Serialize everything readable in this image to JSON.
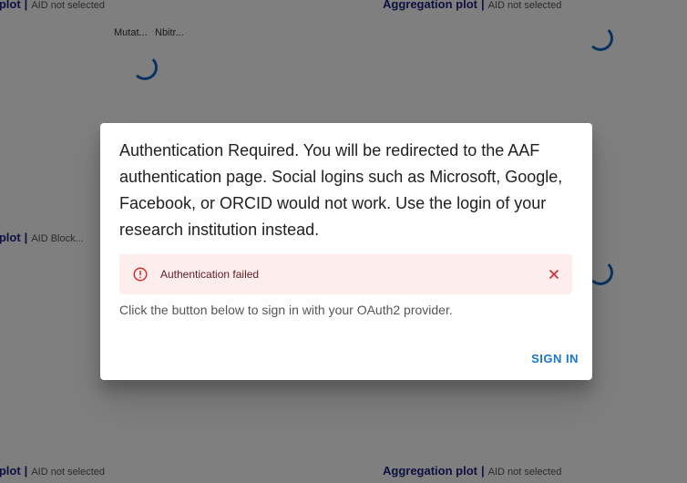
{
  "background": {
    "plots": [
      {
        "title": "y plot",
        "subtitle": "AID not selected"
      },
      {
        "title": "Aggregation plot",
        "subtitle": "AID not selected"
      },
      {
        "title": "y plot",
        "subtitle": "AID Block..."
      },
      {
        "title": "y plot",
        "subtitle": "AID not selected"
      },
      {
        "title": "Aggregation plot",
        "subtitle": "AID not selected"
      }
    ],
    "axis_labels": [
      "Mutat...",
      "Nbitr..."
    ],
    "separator": "|"
  },
  "dialog": {
    "message": "Authentication Required. You will be redirected to the AAF authentication page. Social logins such as Microsoft, Google, Facebook, or ORCID would not work. Use the login of your research institution instead.",
    "alert": {
      "text": "Authentication failed",
      "icon": "error-outline-icon",
      "close_icon": "close-icon"
    },
    "instruction": "Click the button below to sign in with your OAuth2 provider.",
    "signin_label": "SIGN IN"
  },
  "colors": {
    "accent": "#1976d2",
    "alert_bg": "#fdeded",
    "alert_icon": "#d32f2f",
    "alert_text": "#5f2120"
  }
}
